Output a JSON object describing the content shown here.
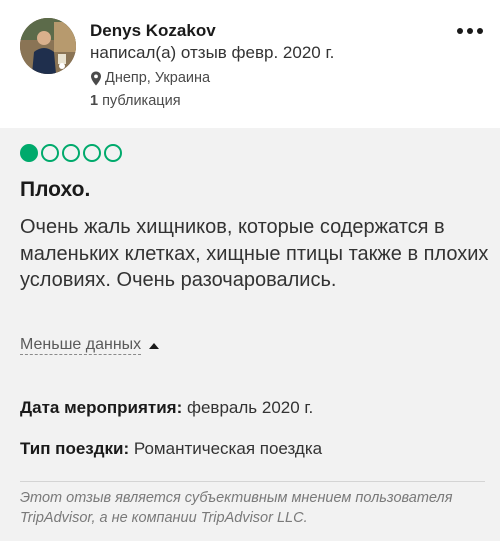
{
  "author": {
    "name": "Denys Kozakov",
    "review_meta": "написал(а) отзыв февр. 2020 г.",
    "location": "Днепр, Украина",
    "contributions_count": "1",
    "contributions_label": "публикация"
  },
  "icons": {
    "more": "more-horizontal-icon",
    "location": "map-pin-icon",
    "collapse": "caret-up-icon"
  },
  "review": {
    "rating": 1,
    "rating_max": 5,
    "title": "Плохо.",
    "text": "Очень жаль хищников, которые содержатся в маленьких клетках, хищные птицы также в плохих условиях. Очень разочаровались.",
    "less_label": "Меньше данных",
    "date_label": "Дата мероприятия:",
    "date_value": "февраль 2020 г.",
    "trip_label": "Тип поездки:",
    "trip_value": "Романтическая поездка",
    "disclaimer": "Этот отзыв является субъективным мнением пользователя TripAdvisor, а не компании TripAdvisor LLC."
  },
  "colors": {
    "rating_green": "#00aa6c",
    "card_background": "#f2f2f2"
  }
}
